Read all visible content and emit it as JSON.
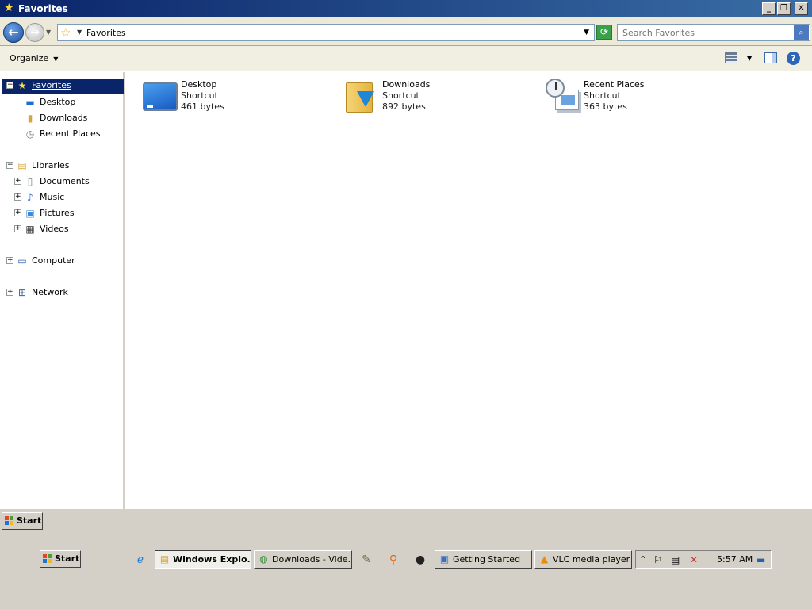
{
  "window": {
    "title": "Favorites",
    "minimize": "_",
    "restore": "❐",
    "close": "✕"
  },
  "address": {
    "path": "Favorites",
    "search_placeholder": "Search Favorites"
  },
  "commandbar": {
    "organize_label": "Organize"
  },
  "navigation": {
    "favorites": {
      "label": "Favorites",
      "children": [
        "Desktop",
        "Downloads",
        "Recent Places"
      ]
    },
    "libraries": {
      "label": "Libraries",
      "children": [
        "Documents",
        "Music",
        "Pictures",
        "Videos"
      ]
    },
    "computer": "Computer",
    "network": "Network"
  },
  "items": [
    {
      "name": "Desktop",
      "type": "Shortcut",
      "size": "461 bytes",
      "icon": "desktop-icon"
    },
    {
      "name": "Downloads",
      "type": "Shortcut",
      "size": "892 bytes",
      "icon": "downloads-folder-icon"
    },
    {
      "name": "Recent Places",
      "type": "Shortcut",
      "size": "363 bytes",
      "icon": "recent-places-icon"
    }
  ],
  "taskbar": {
    "start_label": "Start",
    "tasks": [
      {
        "label": "Windows Explo...",
        "icon": "explorer-icon",
        "active": true
      },
      {
        "label": "Downloads - Vide...",
        "icon": "browser-icon",
        "active": false
      },
      {
        "label": "Getting Started",
        "icon": "window-icon",
        "active": false
      },
      {
        "label": "VLC media player",
        "icon": "vlc-icon",
        "active": false
      }
    ],
    "clock": "5:57 AM"
  }
}
